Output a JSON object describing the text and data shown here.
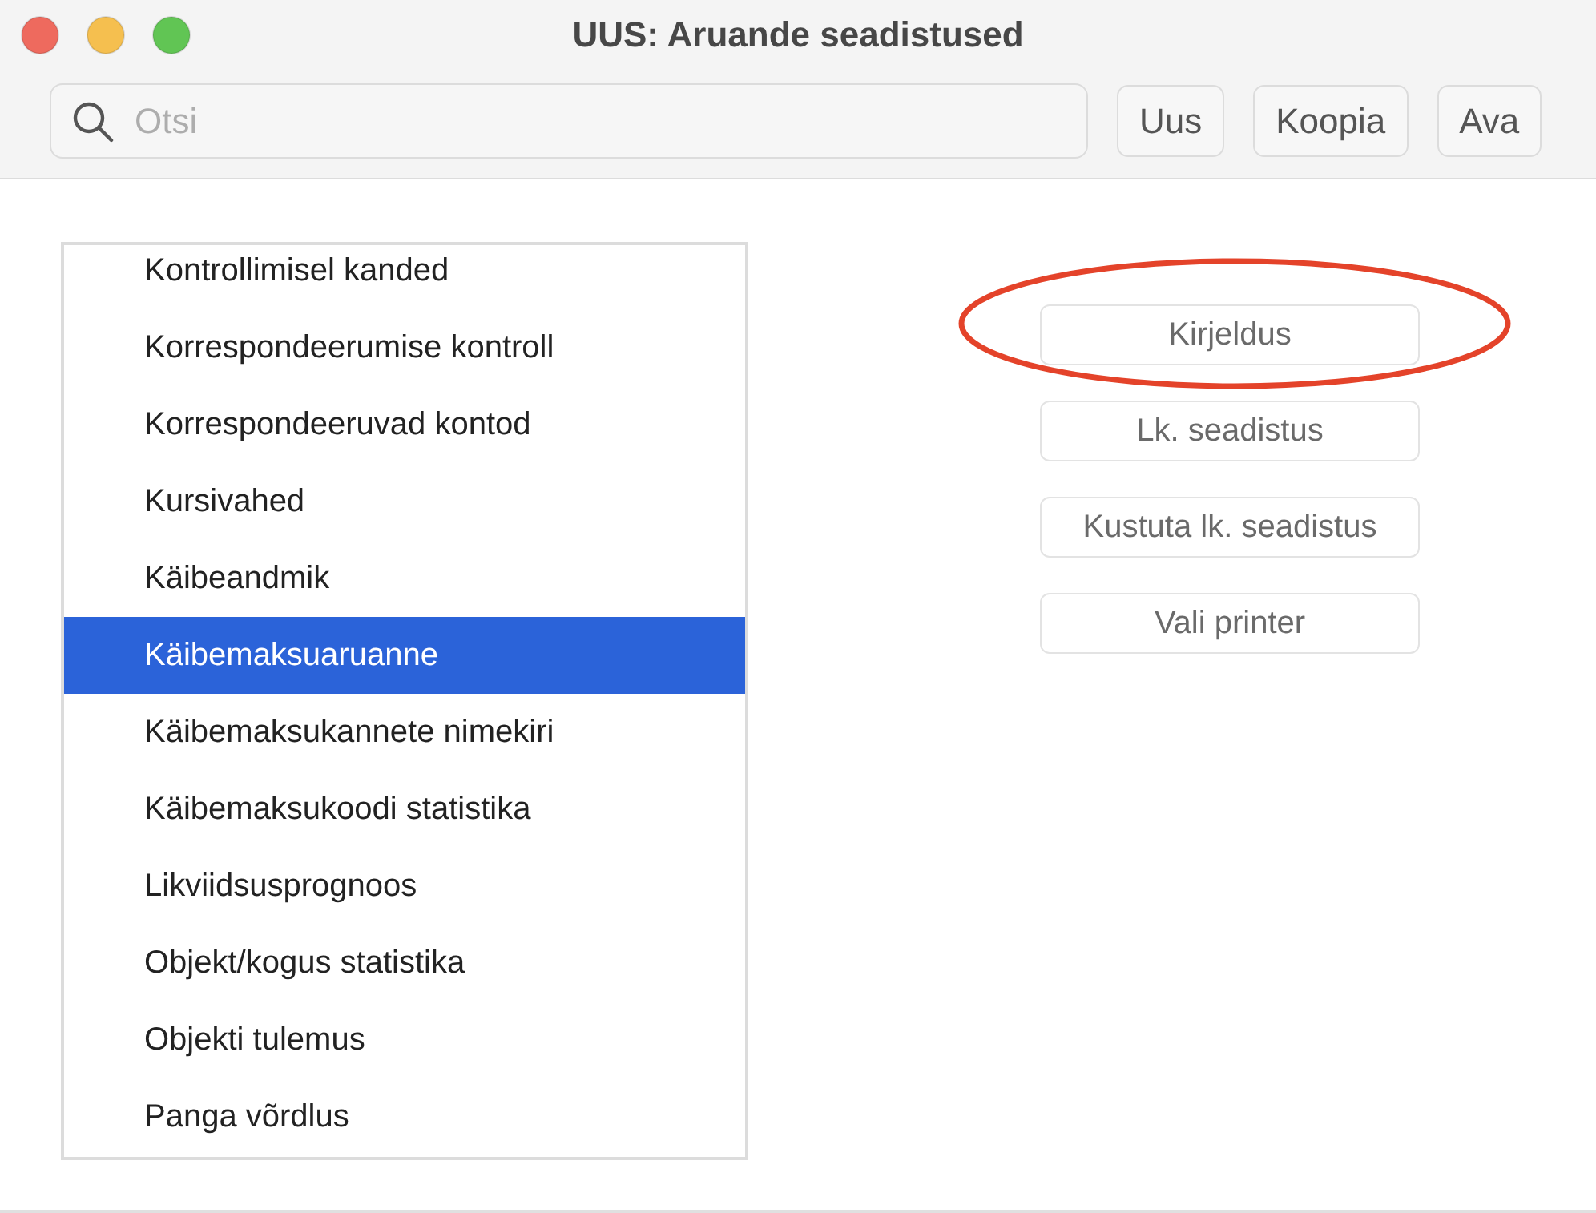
{
  "window": {
    "title": "UUS: Aruande seadistused"
  },
  "toolbar": {
    "search": {
      "placeholder": "Otsi"
    },
    "buttons": [
      {
        "label": "Uus"
      },
      {
        "label": "Koopia"
      },
      {
        "label": "Ava"
      }
    ]
  },
  "report_list": {
    "items": [
      {
        "label": "Kontrollimisel kanded",
        "selected": false
      },
      {
        "label": "Korrespondeerumise kontroll",
        "selected": false
      },
      {
        "label": "Korrespondeeruvad kontod",
        "selected": false
      },
      {
        "label": "Kursivahed",
        "selected": false
      },
      {
        "label": "Käibeandmik",
        "selected": false
      },
      {
        "label": "Käibemaksuaruanne",
        "selected": true
      },
      {
        "label": "Käibemaksukannete nimekiri",
        "selected": false
      },
      {
        "label": "Käibemaksukoodi statistika",
        "selected": false
      },
      {
        "label": "Likviidsusprognoos",
        "selected": false
      },
      {
        "label": "Objekt/kogus statistika",
        "selected": false
      },
      {
        "label": "Objekti tulemus",
        "selected": false
      },
      {
        "label": "Panga võrdlus",
        "selected": false
      }
    ]
  },
  "actions": {
    "buttons": [
      {
        "label": "Kirjeldus",
        "circled": true
      },
      {
        "label": "Lk. seadistus",
        "circled": false
      },
      {
        "label": "Kustuta lk. seadistus",
        "circled": false
      },
      {
        "label": "Vali printer",
        "circled": false
      }
    ]
  }
}
